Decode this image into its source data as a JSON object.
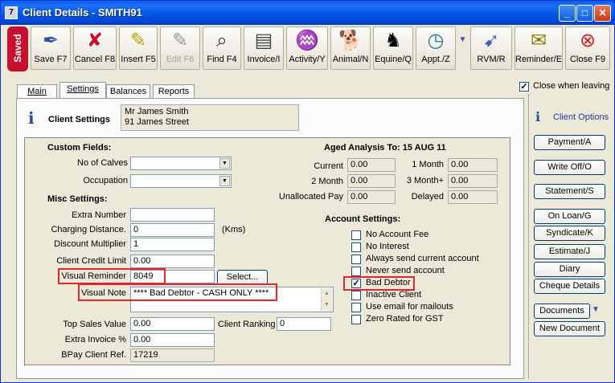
{
  "window": {
    "title": "Client Details - SMITH91",
    "app_icon": "7"
  },
  "toolbar": {
    "saved": "Saved",
    "buttons": [
      {
        "label": "Save F7",
        "icon": "quill-icon"
      },
      {
        "label": "Cancel F8",
        "icon": "cancel-x-icon"
      },
      {
        "label": "Insert F5",
        "icon": "insert-icon"
      },
      {
        "label": "Edit F6",
        "icon": "edit-icon"
      },
      {
        "label": "Find F4",
        "icon": "magnifier-icon"
      },
      {
        "label": "Invoice/I",
        "icon": "invoice-icon"
      },
      {
        "label": "Activity/Y",
        "icon": "activity-icon"
      },
      {
        "label": "Animal/N",
        "icon": "dog-icon"
      },
      {
        "label": "Equine/Q",
        "icon": "horse-icon"
      },
      {
        "label": "Appt./Z",
        "icon": "clock-icon"
      },
      {
        "label": "RVM/R",
        "icon": "rvm-icon"
      },
      {
        "label": "Reminder/E",
        "icon": "reminder-icon"
      },
      {
        "label": "Close F9",
        "icon": "close-circle-icon"
      }
    ]
  },
  "tabs": [
    {
      "label": "Main"
    },
    {
      "label": "Settings"
    },
    {
      "label": "Balances"
    },
    {
      "label": "Reports"
    }
  ],
  "close_when_leaving": "Close when leaving",
  "client": {
    "heading": "Client Settings",
    "name": "Mr James Smith",
    "address": "91 James Street"
  },
  "custom_fields": {
    "heading": "Custom Fields:",
    "calves_label": "No of Calves",
    "calves_value": "",
    "occupation_label": "Occupation",
    "occupation_value": ""
  },
  "misc": {
    "heading": "Misc Settings:",
    "extra_number_label": "Extra Number",
    "extra_number": "",
    "charging_label": "Charging Distance.",
    "charging": "0",
    "kms": "(Kms)",
    "discount_label": "Discount Multiplier",
    "discount": "1",
    "credit_label": "Client Credit Limit",
    "credit": "0.00",
    "visual_reminder_label": "Visual Reminder",
    "visual_reminder": "8049",
    "select_btn": "Select...",
    "visual_note_label": "Visual Note",
    "visual_note": "**** Bad Debtor - CASH ONLY ****",
    "top_sales_label": "Top Sales Value",
    "top_sales": "0.00",
    "ranking_label": "Client Ranking",
    "ranking": "0",
    "extra_invoice_label": "Extra Invoice %",
    "extra_invoice": "0.00",
    "bpay_label": "BPay Client Ref.",
    "bpay": "17219"
  },
  "aged": {
    "heading": "Aged Analysis To: 15 AUG 11",
    "current_label": "Current",
    "current": "0.00",
    "m1_label": "1 Month",
    "m1": "0.00",
    "m2_label": "2 Month",
    "m2": "0.00",
    "m3_label": "3 Month+",
    "m3": "0.00",
    "unalloc_label": "Unallocated Pay",
    "unalloc": "0.00",
    "delayed_label": "Delayed",
    "delayed": "0.00"
  },
  "account": {
    "heading": "Account Settings:",
    "items": [
      {
        "label": "No Account Fee",
        "checked": false
      },
      {
        "label": "No Interest",
        "checked": false
      },
      {
        "label": "Always send current account",
        "checked": false
      },
      {
        "label": "Never send account",
        "checked": false
      },
      {
        "label": "Bad Debtor",
        "checked": true
      },
      {
        "label": "Inactive Client",
        "checked": false
      },
      {
        "label": "Use email for mailouts",
        "checked": false
      },
      {
        "label": "Zero Rated for GST",
        "checked": false
      }
    ]
  },
  "options": {
    "heading": "Client Options",
    "buttons": [
      "Payment/A",
      "Write Off/O",
      "Statement/S",
      "On Loan/G",
      "Syndicate/K",
      "Estimate/J",
      "Diary",
      "Cheque Details",
      "Documents",
      "New Document"
    ]
  }
}
